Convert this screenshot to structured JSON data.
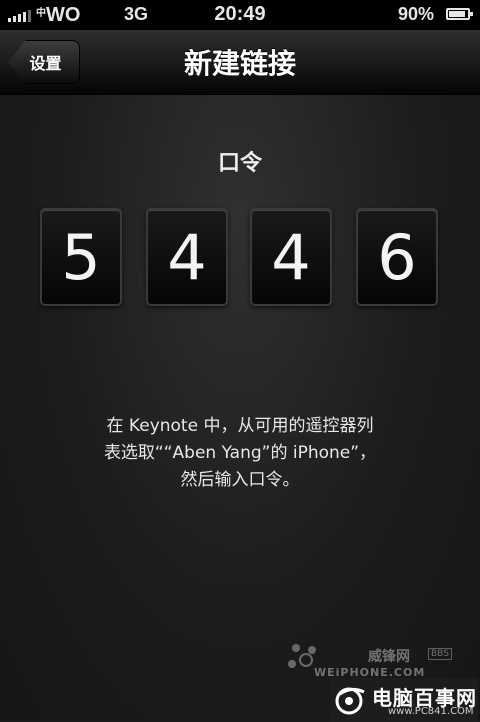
{
  "status_bar": {
    "carrier_small": "中",
    "carrier": "WO",
    "network": "3G",
    "time": "20:49",
    "battery_text": "90%",
    "battery_level": 0.9
  },
  "nav": {
    "back_label": "设置",
    "title": "新建链接"
  },
  "passcode": {
    "label": "口令",
    "digits": [
      "5",
      "4",
      "4",
      "6"
    ]
  },
  "instructions": {
    "line1": "在 Keynote 中，从可用的遥控器列",
    "line2": "表选取““Aben Yang”的 iPhone”，",
    "line3": "然后输入口令。"
  },
  "watermarks": {
    "site1_cn": "威锋网",
    "site1_bbs": "BBS",
    "site1_en": "WEiPHONE.COM",
    "site2_cn": "电脑百事网",
    "site2_en": "www.PC841.COM"
  },
  "colors": {
    "background": "#1b1b1b",
    "status_bar": "#000000",
    "text": "#ffffff"
  }
}
